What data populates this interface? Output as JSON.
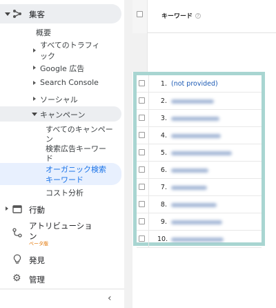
{
  "sidebar": {
    "acquisition": "集客",
    "overview": "概要",
    "all_traffic": "すべてのトラフィ\nック",
    "all_traffic_l1": "すべてのトラフィ",
    "all_traffic_l2": "ック",
    "google_ads": "Google 広告",
    "search_console": "Search Console",
    "social": "ソーシャル",
    "campaigns": "キャンペーン",
    "all_campaigns_l1": "すべてのキャンペー",
    "all_campaigns_l2": "ン",
    "paid_keywords_l1": "検索広告キーワー",
    "paid_keywords_l2": "ド",
    "organic_keywords_l1": "オーガニック検索",
    "organic_keywords_l2": "キーワード",
    "cost_analysis": "コスト分析",
    "behavior": "行動",
    "attribution_l1": "アトリビューショ",
    "attribution_l2": "ン",
    "beta": "ベータ版",
    "discover": "発見",
    "admin": "管理",
    "collapse": "‹"
  },
  "table": {
    "header_keyword": "キーワード",
    "help": "?",
    "rows": [
      {
        "num": "1.",
        "text": "(not provided)"
      },
      {
        "num": "2.",
        "text": ""
      },
      {
        "num": "3.",
        "text": ""
      },
      {
        "num": "4.",
        "text": ""
      },
      {
        "num": "5.",
        "text": ""
      },
      {
        "num": "6.",
        "text": ""
      },
      {
        "num": "7.",
        "text": ""
      },
      {
        "num": "8.",
        "text": ""
      },
      {
        "num": "9.",
        "text": ""
      },
      {
        "num": "10.",
        "text": ""
      }
    ]
  },
  "colors": {
    "highlight_border": "#a8d5d1",
    "active_link": "#1a73e8",
    "beta": "#e37400"
  },
  "icons": [
    "expand-triangle-icon",
    "acquisition-icon",
    "behavior-icon",
    "attribution-icon",
    "discover-lightbulb-icon",
    "admin-gear-icon",
    "collapse-chevron-icon"
  ]
}
